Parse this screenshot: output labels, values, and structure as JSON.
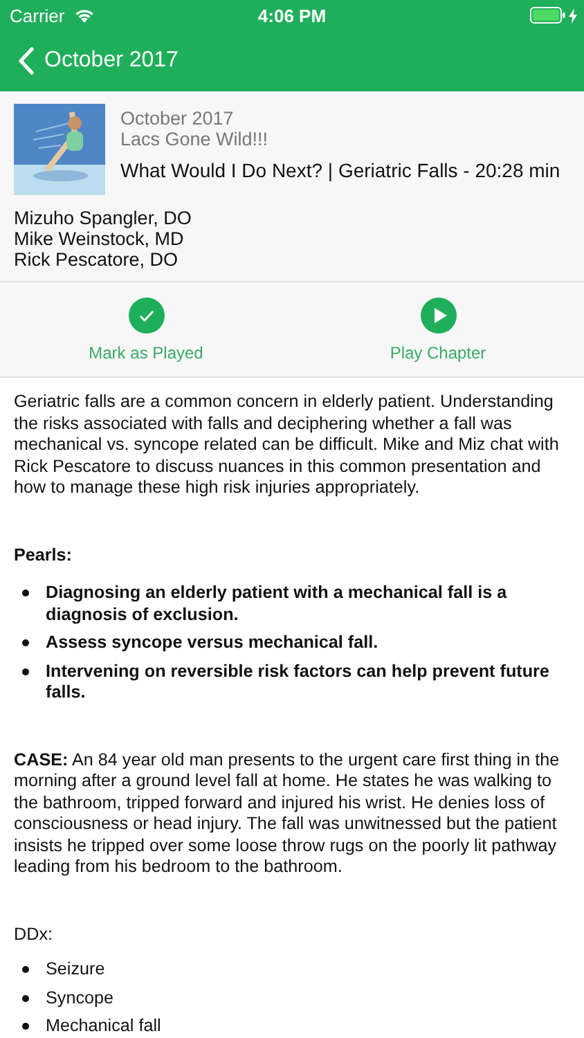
{
  "status_bar": {
    "carrier": "Carrier",
    "time": "4:06 PM"
  },
  "nav_bar": {
    "back_label": "October 2017"
  },
  "episode": {
    "date": "October 2017",
    "series": "Lacs Gone Wild!!!",
    "title": "What Would I Do Next? | Geriatric Falls - 20:28 min",
    "hosts": [
      "Mizuho Spangler, DO",
      "Mike Weinstock, MD",
      "Rick Pescatore, DO"
    ]
  },
  "actions": [
    {
      "kind": "check",
      "label": "Mark as Played"
    },
    {
      "kind": "play",
      "label": "Play Chapter"
    }
  ],
  "description": [
    {
      "kind": "paragraph",
      "text": "Geriatric falls are a common concern in elderly patient. Understanding the risks associated with falls and deciphering whether a fall was mechanical vs. syncope related can be difficult. Mike and Miz chat with Rick Pescatore to discuss nuances in this common presentation and how to manage these high risk injuries appropriately."
    },
    {
      "kind": "heading",
      "text": "Pearls:"
    },
    {
      "kind": "list",
      "bold": true,
      "items": [
        "Diagnosing an elderly  patient with a mechanical fall is a diagnosis of exclusion.",
        "Assess syncope versus mechanical fall.",
        "Intervening on reversible risk factors can help prevent future falls."
      ]
    },
    {
      "kind": "paragraph",
      "text": "**CASE:** An 84 year old man presents to the urgent care first thing in the morning after a ground level fall at home. He states he was walking to the bathroom, tripped forward and injured his wrist. He denies loss of consciousness or head injury.  The fall was unwitnessed but the patient insists he tripped over some loose throw rugs on the poorly lit pathway leading from his bedroom to the bathroom."
    },
    {
      "kind": "label",
      "text": "DDx:"
    },
    {
      "kind": "list",
      "bold": false,
      "items": [
        "Seizure",
        "Syncope",
        "Mechanical fall"
      ]
    }
  ]
}
